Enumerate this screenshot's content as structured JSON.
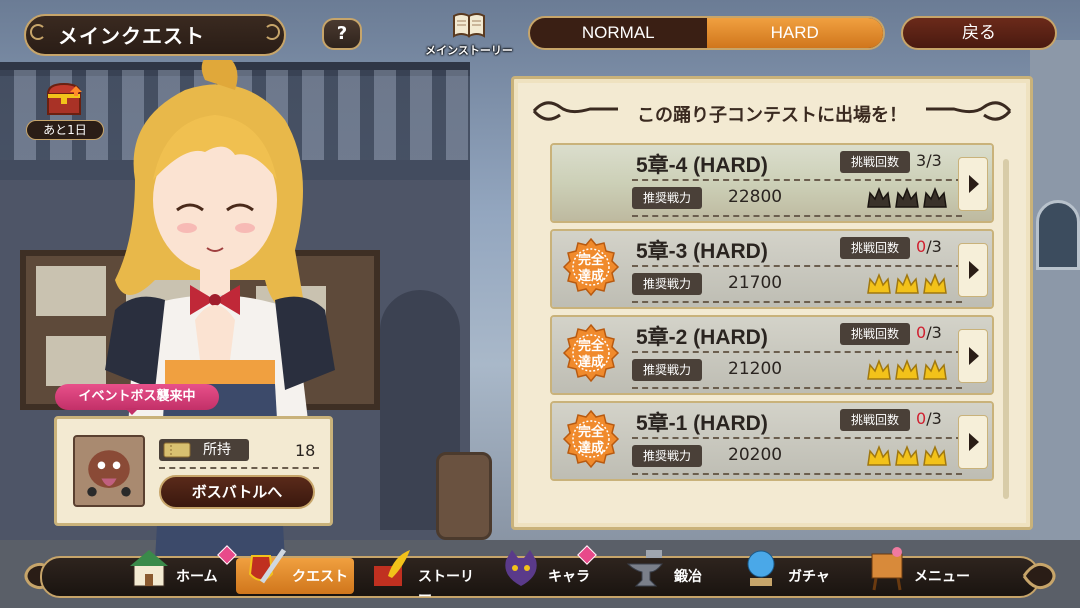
{
  "header": {
    "title": "メインクエスト",
    "help": "?",
    "story_label": "メインストーリー",
    "modes": [
      "NORMAL",
      "HARD"
    ],
    "active_mode": "HARD",
    "back_label": "戻る"
  },
  "treasure": {
    "label": "あと1日"
  },
  "panel": {
    "title": "この踊り子コンテストに出場を！",
    "recommended_label": "推奨戦力",
    "tries_label": "挑戦回数",
    "completed_badge": "完全達成",
    "quests": [
      {
        "name": "5章-4 (HARD)",
        "tries_used": "3",
        "tries_max": "/3",
        "power": "22800",
        "completed": false,
        "crowns": 3
      },
      {
        "name": "5章-3 (HARD)",
        "tries_used": "0",
        "tries_max": "/3",
        "power": "21700",
        "completed": true,
        "crowns": 3
      },
      {
        "name": "5章-2 (HARD)",
        "tries_used": "0",
        "tries_max": "/3",
        "power": "21200",
        "completed": true,
        "crowns": 3
      },
      {
        "name": "5章-1 (HARD)",
        "tries_used": "0",
        "tries_max": "/3",
        "power": "20200",
        "completed": true,
        "crowns": 3
      }
    ]
  },
  "boss": {
    "tag": "イベントボス襲来中",
    "owned_label": "所持",
    "owned_value": "18",
    "button": "ボスバトルへ"
  },
  "nav": {
    "items": [
      {
        "label": "ホーム",
        "icon": "home-icon"
      },
      {
        "label": "クエスト",
        "icon": "sword-shield-icon"
      },
      {
        "label": "ストーリー",
        "icon": "quill-book-icon"
      },
      {
        "label": "キャラ",
        "icon": "cat-icon"
      },
      {
        "label": "鍛冶",
        "icon": "anvil-icon"
      },
      {
        "label": "ガチャ",
        "icon": "crystal-ball-icon"
      },
      {
        "label": "メニュー",
        "icon": "signboard-icon"
      }
    ],
    "active": "クエスト"
  },
  "colors": {
    "accent_orange": "#e08a2c",
    "gold_border": "#c7a56a",
    "parchment": "#f3ead2",
    "dark_brown": "#2a1d16",
    "pink": "#e8508a",
    "red_count": "#d02030",
    "crown_gold": "#f2c21a"
  }
}
